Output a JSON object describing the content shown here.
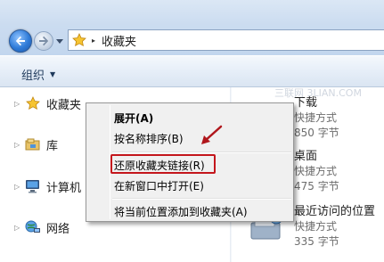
{
  "address": {
    "path": "收藏夹",
    "separator": "▸"
  },
  "toolbar": {
    "organize_label": "组织",
    "organize_caret": "▼"
  },
  "nav": {
    "expander": "▷",
    "items": [
      {
        "label": "收藏夹",
        "icon": "star-icon"
      },
      {
        "label": "库",
        "icon": "library-icon"
      },
      {
        "label": "计算机",
        "icon": "computer-icon"
      },
      {
        "label": "网络",
        "icon": "network-icon"
      }
    ]
  },
  "content": {
    "items": [
      {
        "name": "下载",
        "type": "快捷方式",
        "size": "850 字节",
        "icon": "folder-icon"
      },
      {
        "name": "桌面",
        "type": "快捷方式",
        "size": "475 字节",
        "icon": "desktop-icon"
      },
      {
        "name": "最近访问的位置",
        "type": "快捷方式",
        "size": "335 字节",
        "icon": "recent-places-icon"
      }
    ]
  },
  "watermark": "三联网 3LIAN.COM",
  "context_menu": {
    "items": [
      {
        "label": "展开(A)",
        "bold": true
      },
      {
        "label": "按名称排序(B)"
      },
      {
        "label": "还原收藏夹链接(R)",
        "highlighted": true
      },
      {
        "label": "在新窗口中打开(E)"
      },
      {
        "label": "将当前位置添加到收藏夹(A)"
      }
    ]
  },
  "colors": {
    "highlight_box": "#c4161c",
    "arrow": "#b0161c",
    "titlebar": "#cbdcf0"
  }
}
